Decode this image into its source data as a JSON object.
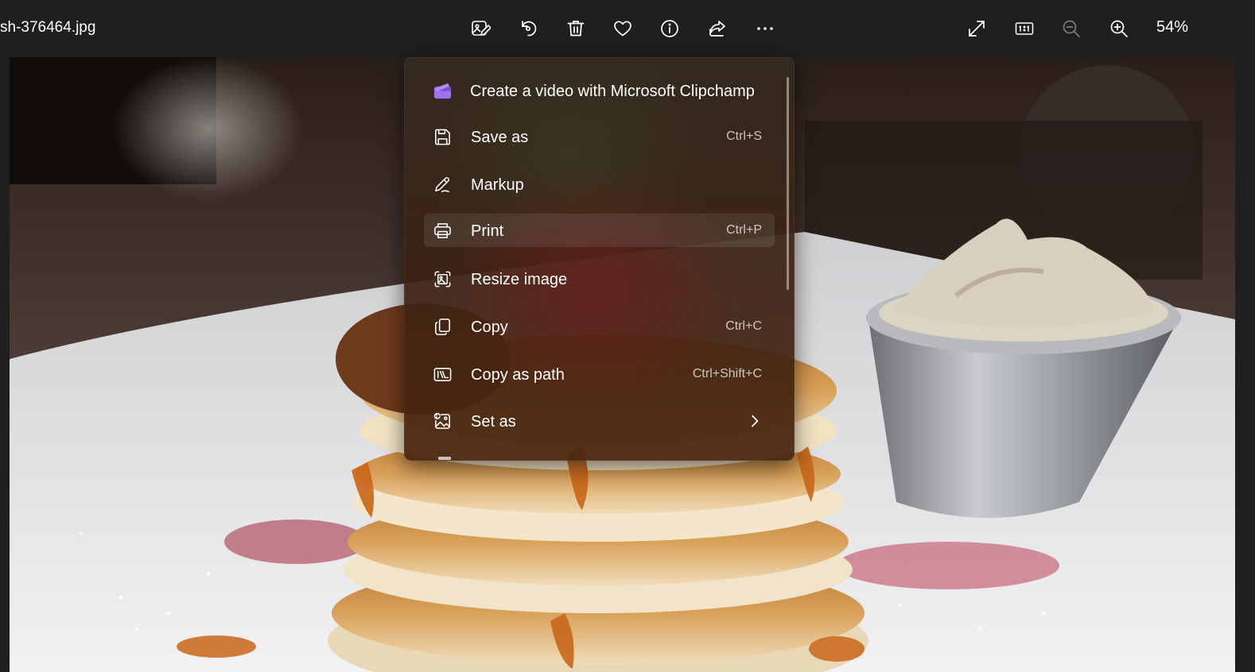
{
  "window": {
    "filename": "sh-376464.jpg"
  },
  "toolbar": {
    "buttons": [
      {
        "name": "edit-image",
        "icon": "edit-image-icon"
      },
      {
        "name": "rotate",
        "icon": "rotate-icon"
      },
      {
        "name": "delete",
        "icon": "trash-icon"
      },
      {
        "name": "favorite",
        "icon": "heart-icon"
      },
      {
        "name": "file-info",
        "icon": "info-icon"
      },
      {
        "name": "share",
        "icon": "share-icon"
      },
      {
        "name": "see-more",
        "icon": "more-icon"
      }
    ],
    "view_buttons": [
      {
        "name": "full-screen",
        "icon": "expand-icon"
      },
      {
        "name": "actual-size",
        "icon": "actual-size-icon",
        "text": "1:1"
      },
      {
        "name": "zoom-out",
        "icon": "zoom-out-icon",
        "disabled": true
      },
      {
        "name": "zoom-in",
        "icon": "zoom-in-icon"
      }
    ],
    "zoom_level": "54%"
  },
  "menu": {
    "items": [
      {
        "label": "Create a video with Microsoft Clipchamp",
        "shortcut": "",
        "icon": "clipchamp-icon"
      },
      {
        "label": "Save as",
        "shortcut": "Ctrl+S",
        "icon": "save-icon"
      },
      {
        "label": "Markup",
        "shortcut": "",
        "icon": "pen-icon"
      },
      {
        "label": "Print",
        "shortcut": "Ctrl+P",
        "icon": "printer-icon",
        "highlighted": true
      },
      {
        "label": "Resize image",
        "shortcut": "",
        "icon": "resize-icon"
      },
      {
        "label": "Copy",
        "shortcut": "Ctrl+C",
        "icon": "copy-icon"
      },
      {
        "label": "Copy as path",
        "shortcut": "Ctrl+Shift+C",
        "icon": "copy-path-icon"
      },
      {
        "label": "Set as",
        "shortcut": "",
        "icon": "set-as-icon",
        "submenu": true
      }
    ]
  },
  "colors": {
    "toolbar_bg": "#1f1f1f",
    "text": "#ffffff",
    "clipchamp_purple": "#8b5cf6"
  }
}
